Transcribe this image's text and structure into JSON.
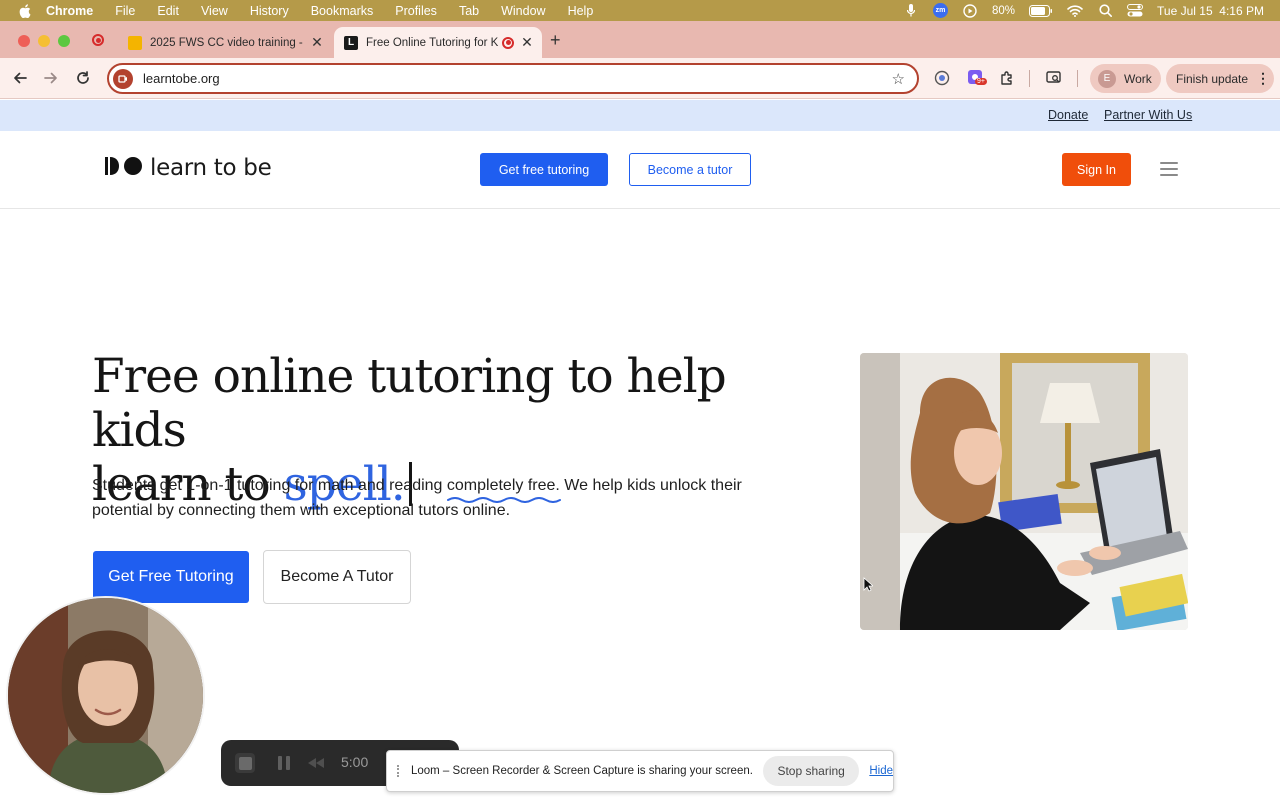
{
  "menubar": {
    "app": "Chrome",
    "items": [
      "File",
      "Edit",
      "View",
      "History",
      "Bookmarks",
      "Profiles",
      "Tab",
      "Window",
      "Help"
    ],
    "battery": "80%",
    "zoom_badge": "zm",
    "datetime": "Tue Jul 15  4:16 PM"
  },
  "tabs": [
    {
      "title": "2025 FWS CC video training -",
      "favicon": "google-slides-icon",
      "active": false
    },
    {
      "title": "Free Online Tutoring for K",
      "favicon": "learntobe-icon",
      "active": true
    }
  ],
  "toolbar": {
    "url": "learntobe.org",
    "profile_initial": "E",
    "profile_name": "Work",
    "update_label": "Finish update",
    "extension_badge": "9+"
  },
  "site": {
    "top_links": [
      "Donate",
      "Partner With Us"
    ],
    "logo_text": "learn to be",
    "nav_get_tutoring": "Get free tutoring",
    "nav_become_tutor": "Become a tutor",
    "sign_in": "Sign In",
    "hero_line1": "Free online tutoring to help kids",
    "hero_line2_prefix": "learn to ",
    "hero_accent_word": "spell.",
    "hero_text_before": "Students get 1-on-1 tutoring for math and reading ",
    "hero_text_highlight": "completely free",
    "hero_text_after": ". We help kids unlock their potential by connecting them with exceptional tutors online.",
    "cta_primary": "Get Free Tutoring",
    "cta_secondary": "Become A Tutor"
  },
  "loom": {
    "timer": "5:00",
    "share_message": "Loom – Screen Recorder & Screen Capture is sharing your screen.",
    "stop_label": "Stop sharing",
    "hide_label": "Hide"
  },
  "colors": {
    "menubar_bg": "#b59a49",
    "tabstrip_bg": "#e8b8b0",
    "brand_blue": "#1f5ef0",
    "sign_in_orange": "#f04e0b",
    "accent_word": "#2f64e0",
    "topbar_bg": "#dbe7fb"
  }
}
